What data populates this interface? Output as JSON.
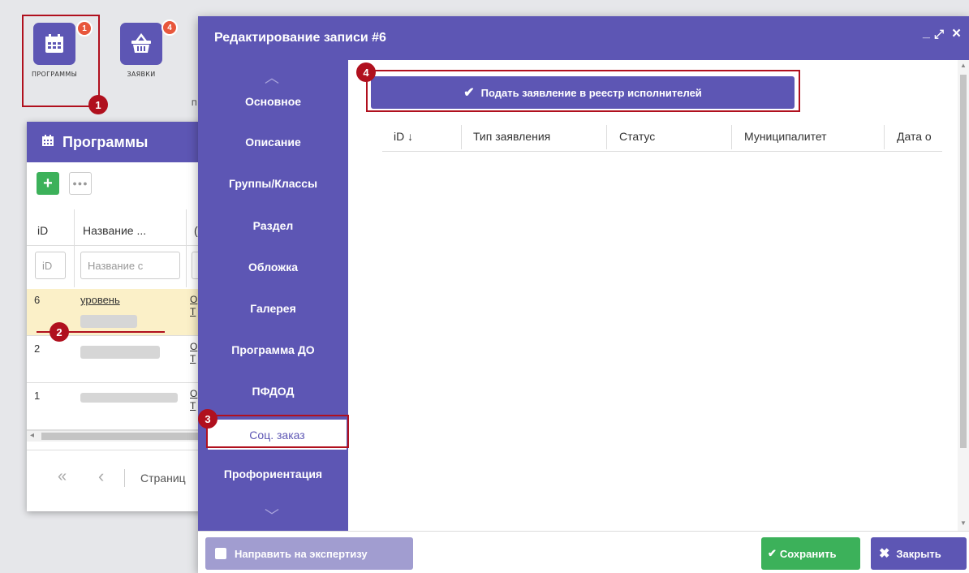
{
  "desktop": {
    "programs_caption": "ПРОГРАММЫ",
    "programs_badge": "1",
    "requests_caption": "ЗАЯВКИ",
    "requests_badge": "4",
    "third_caption": "П"
  },
  "programs_window": {
    "title": "Программы",
    "columns": [
      "iD",
      "Название ...",
      "("
    ],
    "filters": [
      "iD",
      "Название с"
    ],
    "rows": [
      {
        "id": "6",
        "name": "уровень",
        "extra": "О Т"
      },
      {
        "id": "2",
        "name": "",
        "extra": "О Т"
      },
      {
        "id": "1",
        "name": "",
        "extra": "О Т"
      }
    ],
    "pager_first": "«",
    "pager_prev": "‹",
    "pager_label": "Страниц"
  },
  "modal": {
    "title": "Редактирование записи #6",
    "controls": {
      "minimize": "_",
      "maximize": "⤢",
      "close": "×"
    },
    "nav_up": "︿",
    "nav_down": "﹀",
    "sidebar": [
      "Основное",
      "Описание",
      "Группы/Классы",
      "Раздел",
      "Обложка",
      "Галерея",
      "Программа ДО",
      "ПФДОД",
      "Соц. заказ",
      "Профориентация"
    ],
    "active_index": 8,
    "apply_button": "Подать заявление в реестр исполнителей",
    "table_columns": [
      "iD ↓",
      "Тип заявления",
      "Статус",
      "Муниципалитет",
      "Дата о"
    ],
    "footer": {
      "expertise": "Направить на экспертизу",
      "save": "Сохранить",
      "close": "Закрыть"
    }
  },
  "markers": [
    "1",
    "2",
    "3",
    "4"
  ],
  "colors": {
    "brand": "#5d56b4",
    "marker": "#b0101e",
    "save": "#3cb15a",
    "badge": "#e8573c"
  }
}
